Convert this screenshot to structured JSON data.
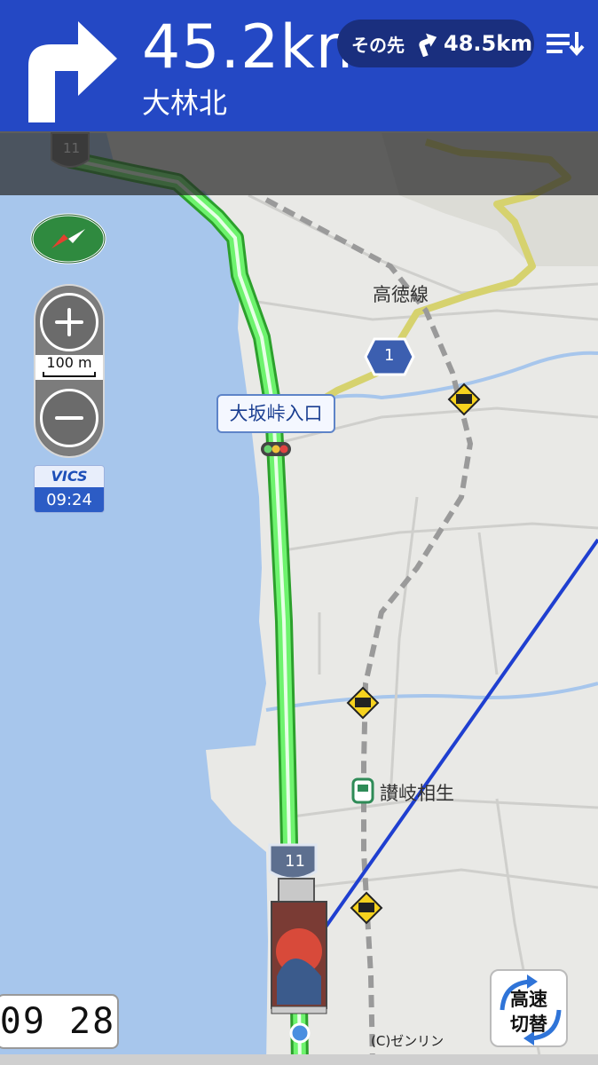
{
  "nav": {
    "distance": "45.2km",
    "road_name": "大林北",
    "next_label": "その先",
    "next_distance": "48.5km"
  },
  "controls": {
    "scale": "100 m",
    "vics_label": "VICS",
    "vics_time": "09:24"
  },
  "map": {
    "route_shield_top": "11",
    "route_shield_near": "11",
    "route_shield_national": "1",
    "callout": "大坂峠入口",
    "line_label": "高徳線",
    "station_label": "讃岐相生",
    "copyright": "(C)ゼンリン"
  },
  "clock": "09 28",
  "highway_toggle": {
    "line1": "高速",
    "line2": "切替"
  },
  "colors": {
    "banner": "#2448c4",
    "route": "#4be34b",
    "sea": "#a7c6ec",
    "land": "#e9e9e6",
    "rail_line": "#1f3fd0"
  }
}
